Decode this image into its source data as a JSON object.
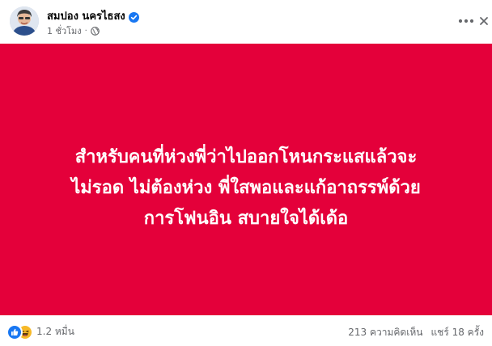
{
  "post": {
    "author_name": "สมปอง นครไธสง",
    "timestamp": "1 ชั่วโมง",
    "meta_separator": "·",
    "background_color": "#e4003a",
    "text_lines": [
      "สำหรับคนที่ห่วงพี่ว่าไปออกโหนกระแสแล้วจะ",
      "ไม่รอด ไม่ต้องห่วง พี่ใสพอและแก้อาถรรพ์ด้วย",
      "การโฟนอิน สบายใจได้เด้อ"
    ]
  },
  "footer": {
    "reaction_count": "1.2 หมื่น",
    "comments": "213 ความคิดเห็น",
    "shares": "แชร์ 18 ครั้ง"
  },
  "icons": {
    "verified": "verified-badge-icon",
    "audience": "public-globe-icon",
    "more": "more-options-icon",
    "like": "like-reaction-icon",
    "haha": "haha-reaction-icon"
  },
  "colors": {
    "brand_blue": "#1877f2",
    "secondary_text": "#65676b"
  }
}
